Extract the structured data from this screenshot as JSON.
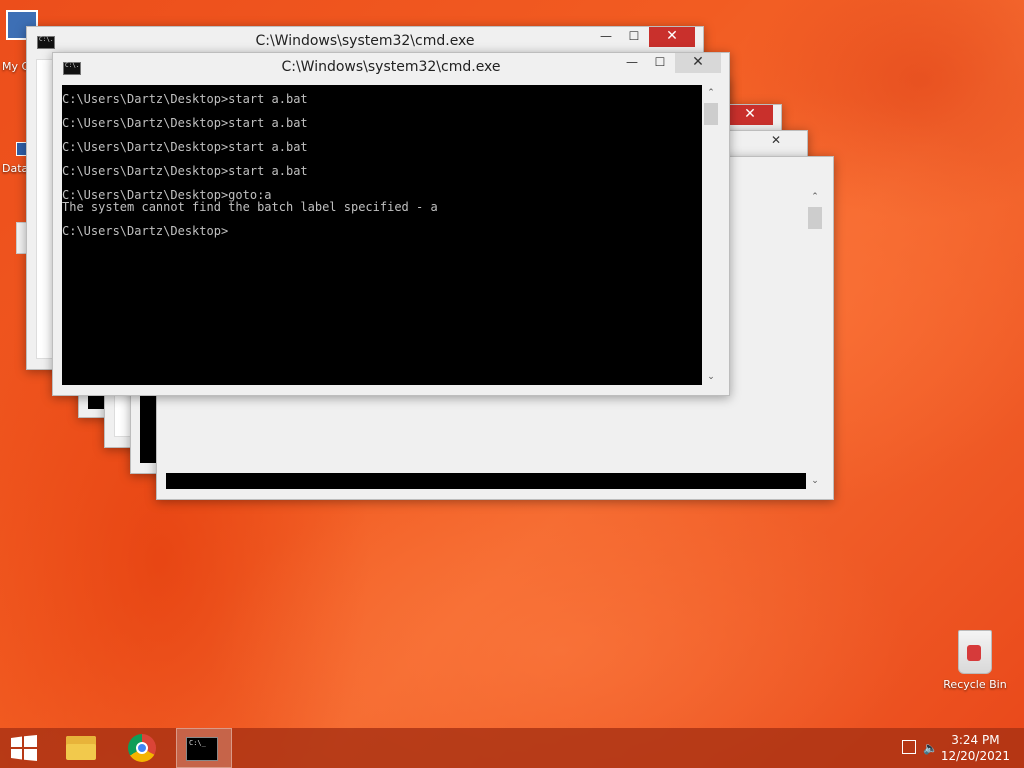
{
  "desktop": {
    "icons": [
      {
        "label": "My C",
        "icon": "computer-icon"
      },
      {
        "label": "Data",
        "icon": "data-icon"
      },
      {
        "label": "Recycle Bin",
        "icon": "recycle-bin-icon"
      }
    ]
  },
  "windows": {
    "title": "C:\\Windows\\system32\\cmd.exe",
    "back_title": "C:\\Windows\\system32\\cmd.exe",
    "front_title": "C:\\Windows\\system32\\cmd.exe",
    "minimize": "—",
    "maximize": "☐",
    "close": "✕"
  },
  "console": {
    "lines": [
      "C:\\Users\\Dartz\\Desktop>start a.bat",
      "",
      "C:\\Users\\Dartz\\Desktop>start a.bat",
      "",
      "C:\\Users\\Dartz\\Desktop>start a.bat",
      "",
      "C:\\Users\\Dartz\\Desktop>start a.bat",
      "",
      "C:\\Users\\Dartz\\Desktop>goto:a",
      "The system cannot find the batch label specified - a",
      "",
      "C:\\Users\\Dartz\\Desktop>"
    ]
  },
  "taskbar": {
    "items": [
      "start-button",
      "file-explorer",
      "chrome",
      "command-prompt"
    ],
    "clock": {
      "time": "3:24 PM",
      "date": "12/20/2021"
    }
  },
  "colors": {
    "accent": "#e9481a",
    "close": "#c9302c",
    "console_bg": "#000000",
    "console_fg": "#c0c0c0"
  }
}
